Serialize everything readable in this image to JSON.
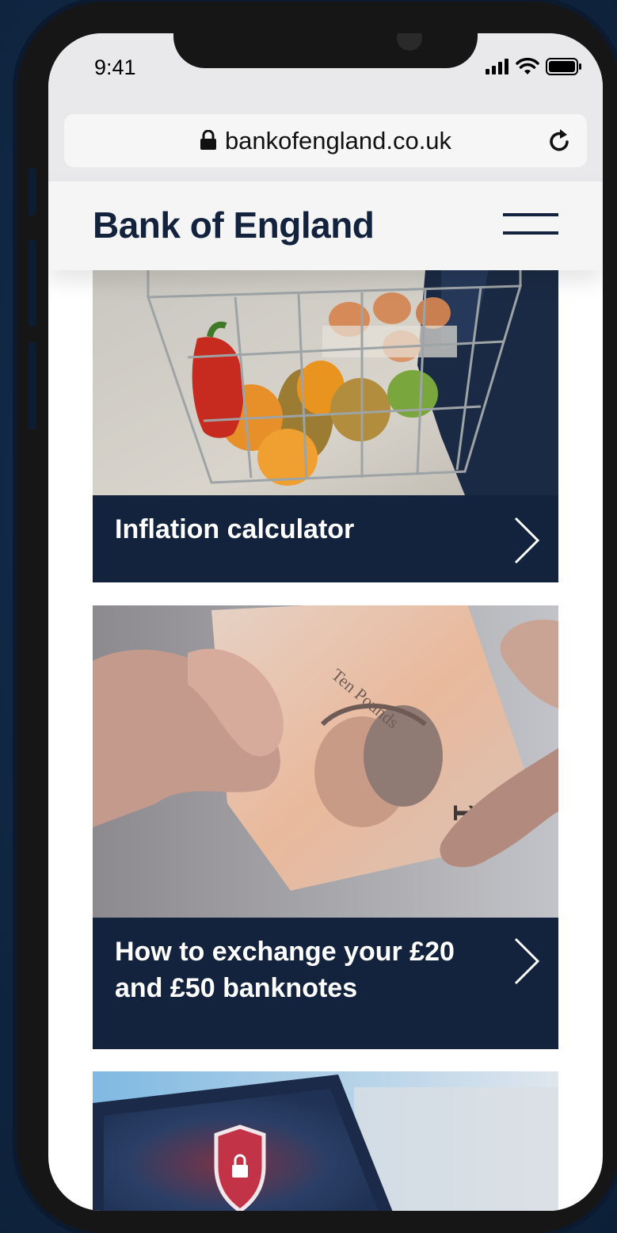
{
  "status_bar": {
    "time": "9:41",
    "icons": [
      "signal-icon",
      "wifi-icon",
      "battery-icon"
    ]
  },
  "browser": {
    "url": "bankofengland.co.uk",
    "lock_icon": "lock-icon",
    "reload_icon": "reload-icon"
  },
  "header": {
    "logo": "Bank of England",
    "menu_icon": "hamburger-menu-icon"
  },
  "cards": [
    {
      "title": "Inflation calculator",
      "image": "shopping basket with vegetables and eggs",
      "arrow_icon": "chevron-right-icon"
    },
    {
      "title": "How to exchange your £20 and £50 banknotes",
      "image": "hands exchanging ten pound banknote",
      "arrow_icon": "chevron-right-icon"
    },
    {
      "title": "",
      "image": "laptop screen with security shield padlock"
    }
  ],
  "colors": {
    "background": "#102742",
    "brand_navy": "#14233d",
    "header_bg": "#f5f5f6"
  }
}
